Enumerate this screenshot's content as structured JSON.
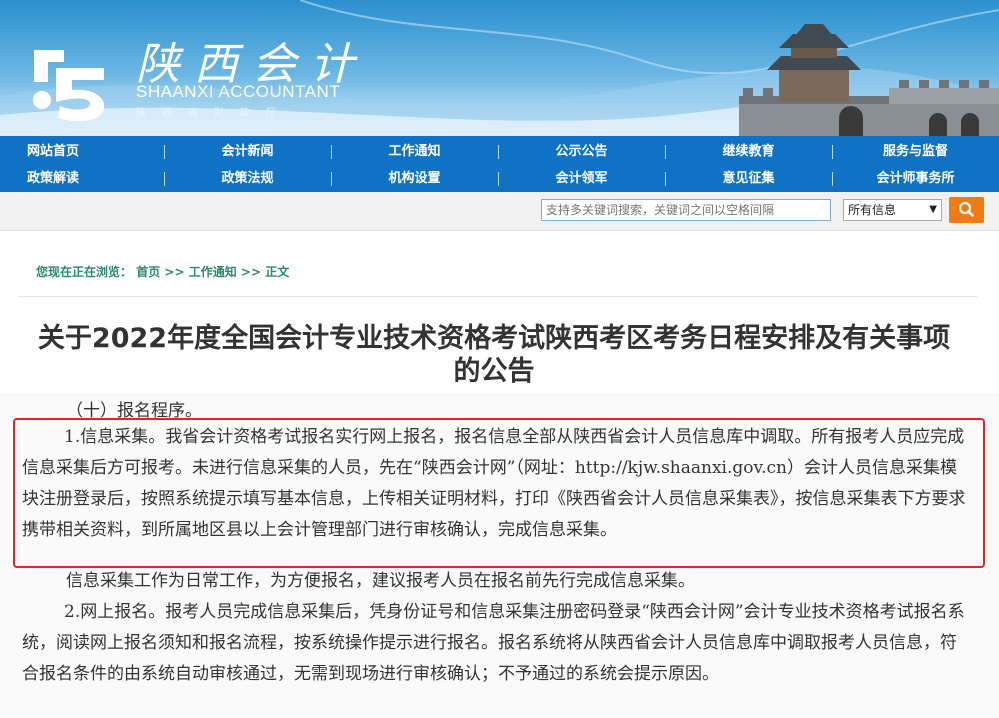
{
  "header": {
    "site_name_cn": "陕西会计",
    "site_name_en": "SHAANXI ACCOUNTANT",
    "site_name_sub": "陕西省财政厅"
  },
  "nav": {
    "row1": [
      "网站首页",
      "会计新闻",
      "工作通知",
      "公示公告",
      "继续教育",
      "服务与监督"
    ],
    "row2": [
      "政策解读",
      "政策法规",
      "机构设置",
      "会计领军",
      "意见征集",
      "会计师事务所"
    ]
  },
  "search": {
    "placeholder": "支持多关键词搜索，关键词之间以空格间隔",
    "scope_selected": "所有信息"
  },
  "breadcrumb": {
    "prefix": "您现在正在浏览：",
    "home": "首页",
    "sep": ">>",
    "section": "工作通知",
    "current": "正文"
  },
  "article": {
    "title_line1": "关于2022年度全国会计专业技术资格考试陕西考区考务日程安排及有关事项",
    "title_line2": "的公告",
    "heading": "（十）报名程序。",
    "collect": "1.信息采集。我省会计资格考试报名实行网上报名，报名信息全部从陕西省会计人员信息库中调取。所有报考人员应完成信息采集后方可报考。未进行信息采集的人员，先在“陕西会计网”（网址：http://kjw.shaanxi.gov.cn）会计人员信息采集模块注册登录后，按照系统提示填写基本信息，上传相关证明材料，打印《陕西省会计人员信息采集表》，按信息采集表下方要求携带相关资料，到所属地区县以上会计管理部门进行审核确认，完成信息采集。",
    "note": "信息采集工作为日常工作，为方便报名，建议报考人员在报名前先行完成信息采集。",
    "online": "2.网上报名。报考人员完成信息采集后，凭身份证号和信息采集注册密码登录“陕西会计网”会计专业技术资格考试报名系统，阅读网上报名须知和报名流程，按系统操作提示进行报名。报名系统将从陕西省会计人员信息库中调取报考人员信息，符合报名条件的由系统自动审核通过，无需到现场进行审核确认；不予通过的系统会提示原因。"
  },
  "colors": {
    "nav_bg": "#0f72c4",
    "highlight": "#e0242a",
    "search_button": "#f07b13",
    "breadcrumb": "#2b8a6e"
  }
}
